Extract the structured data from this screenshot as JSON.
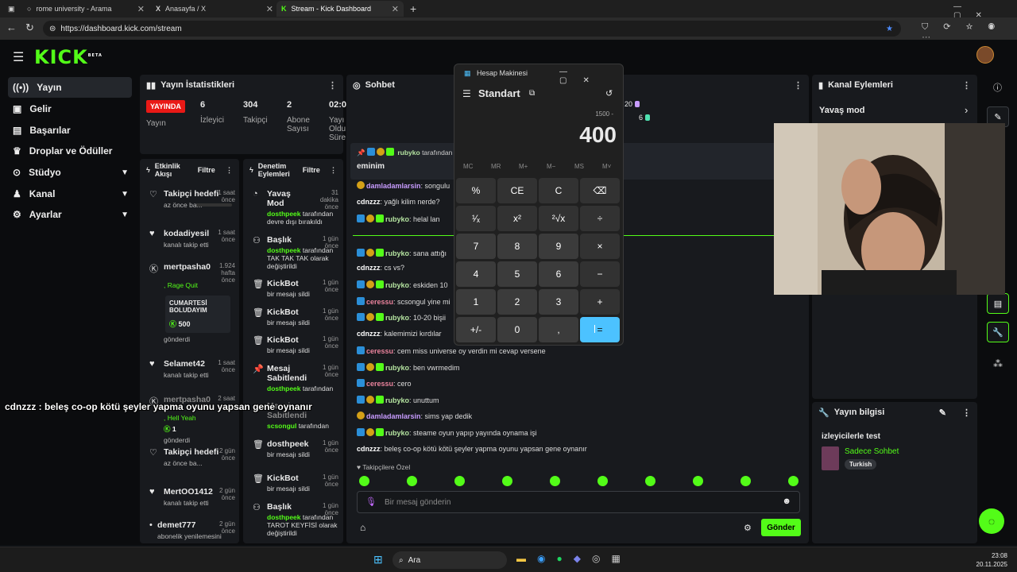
{
  "browser": {
    "tabs": [
      {
        "title": "rome university - Arama",
        "active": false
      },
      {
        "title": "Anasayfa / X",
        "active": false
      },
      {
        "title": "Stream - Kick Dashboard",
        "active": true
      }
    ],
    "url": "https://dashboard.kick.com/stream"
  },
  "kick": {
    "logo": "KICK",
    "logo_sup": "BETA",
    "sidebar": [
      {
        "label": "Yayın",
        "icon": "broadcast-icon",
        "active": true
      },
      {
        "label": "Gelir",
        "icon": "money-icon"
      },
      {
        "label": "Başarılar",
        "icon": "chart-icon"
      },
      {
        "label": "Droplar ve Ödüller",
        "icon": "trophy-icon"
      },
      {
        "label": "Stüdyo",
        "icon": "studio-icon",
        "expand": true
      },
      {
        "label": "Kanal",
        "icon": "people-icon",
        "expand": true
      },
      {
        "label": "Ayarlar",
        "icon": "gear-icon",
        "expand": true
      }
    ],
    "stats": {
      "title": "Yayın İstatistikleri",
      "items": [
        {
          "value": "YAYINDA",
          "label": "Yayın"
        },
        {
          "value": "6",
          "label": "İzleyici"
        },
        {
          "value": "304",
          "label": "Takipçi"
        },
        {
          "value": "2",
          "label": "Abone Sayısı"
        },
        {
          "value": "02:0",
          "label": "Yayı Oldu Süre"
        }
      ]
    },
    "activity": {
      "title": "Etkinlik Akışı",
      "filter": "Filtre",
      "items": [
        {
          "title": "Takipçi hedefi",
          "time": "1 saat önce",
          "sub": "az önce ba..."
        },
        {
          "title": "kodadiyesil",
          "time": "1 saat önce",
          "sub": "kanalı takip etti"
        },
        {
          "title": "mertpasha0",
          "time": "1.924 hafta önce",
          "sub": ", Rage Quit",
          "card": "CUMARTESİ BOLUDAYIM",
          "amount": "500",
          "sub2": "gönderdi"
        },
        {
          "title": "Selamet42",
          "time": "1 saat önce",
          "sub": "kanalı takip etti"
        },
        {
          "title": "mertpasha0",
          "time": "2 saat",
          "sub": ", Hell Yeah",
          "amount": "1",
          "sub2": "gönderdi"
        },
        {
          "title": "Takipçi hedefi",
          "time": "2 gün önce",
          "sub": "az önce ba..."
        },
        {
          "title": "MertOO1412",
          "time": "2 gün önce",
          "sub": "kanalı takip etti"
        },
        {
          "title": "demet777",
          "time": "2 gün önce",
          "sub": "abonelik yenilemesini"
        }
      ]
    },
    "moderation": {
      "title": "Denetim Eylemleri",
      "filter": "Filtre",
      "items": [
        {
          "title": "Yavaş Mod",
          "time": "31 dakika önce",
          "actor": "dosthpeek",
          "rest": "tarafından devre dışı bırakıldı"
        },
        {
          "title": "Başlık",
          "time": "1 gün önce",
          "actor": "dosthpeek",
          "rest": "tarafından TAK TAK TAK olarak değiştirildi"
        },
        {
          "title": "KickBot",
          "time": "1 gün önce",
          "rest": "bir mesajı sildi"
        },
        {
          "title": "KickBot",
          "time": "1 gün önce",
          "rest": "bir mesajı sildi"
        },
        {
          "title": "KickBot",
          "time": "1 gün önce",
          "rest": "bir mesajı sildi"
        },
        {
          "title": "Mesaj Sabitlendi",
          "time": "1 gün önce",
          "actor": "dosthpeek",
          "rest": "tarafından"
        },
        {
          "title": "Mesaj Sabitlendi",
          "time": "",
          "actor": "scsongul",
          "rest": "tarafından"
        },
        {
          "title": "dosthpeek",
          "time": "1 gün önce",
          "rest": "bir mesajı sildi"
        },
        {
          "title": "KickBot",
          "time": "1 gün önce",
          "rest": "bir mesajı sildi"
        },
        {
          "title": "Başlık",
          "time": "1 gün önce",
          "actor": "dosthpeek",
          "rest": "tarafından TAROT KEYFİSİ olarak değiştirildi"
        }
      ]
    },
    "chat": {
      "title": "Sohbet",
      "pinned_user": "rubyko",
      "pinned_suffix": "tarafından",
      "pinned_text": "eminim",
      "top_counts": [
        "20",
        "6"
      ],
      "messages": [
        {
          "user": "damladamlarsin",
          "text": "songulu",
          "color": "purple",
          "badges": [
            "y"
          ]
        },
        {
          "user": "cdnzzz",
          "text": "yağlı kilim nerde?",
          "color": "white",
          "badges": []
        },
        {
          "user": "rubyko",
          "text": "helal lan",
          "color": "green",
          "badges": [
            "b",
            "y",
            "g"
          ]
        },
        {
          "user": "rubyko",
          "text": "sana attığı",
          "color": "green",
          "badges": [
            "b",
            "y",
            "g"
          ]
        },
        {
          "user": "cdnzzz",
          "text": "cs vs?",
          "color": "white",
          "badges": []
        },
        {
          "user": "rubyko",
          "text": "eskiden 10",
          "color": "green",
          "badges": [
            "b",
            "y",
            "g"
          ]
        },
        {
          "user": "ceressu",
          "text": "scsongul yine mi",
          "color": "pink",
          "badges": [
            "b"
          ]
        },
        {
          "user": "rubyko",
          "text": "10-20 bişii",
          "color": "green",
          "badges": [
            "b",
            "y",
            "g"
          ]
        },
        {
          "user": "cdnzzz",
          "text": "kalemimizi kırdılar",
          "color": "white",
          "badges": []
        },
        {
          "user": "ceressu",
          "text": "cem miss universe oy verdin mi cevap versene",
          "color": "pink",
          "badges": [
            "b"
          ]
        },
        {
          "user": "rubyko",
          "text": "ben vwrmedim",
          "color": "green",
          "badges": [
            "b",
            "y",
            "g"
          ]
        },
        {
          "user": "ceressu",
          "text": "cero",
          "color": "pink",
          "badges": [
            "b"
          ]
        },
        {
          "user": "rubyko",
          "text": "unuttum",
          "color": "green",
          "badges": [
            "b",
            "y",
            "g"
          ]
        },
        {
          "user": "damladamlarsin",
          "text": "sims yap dedik",
          "color": "purple",
          "badges": [
            "y"
          ]
        },
        {
          "user": "rubyko",
          "text": "steame oyun yapıp yayında oynama işi",
          "color": "green",
          "badges": [
            "b",
            "y",
            "g"
          ]
        },
        {
          "user": "cdnzzz",
          "text": "beleş co-op kötü kötü şeyler yapma oyunu yapsan gene oynanır",
          "color": "white",
          "badges": []
        }
      ],
      "emote_label": "Takipçilere Özel",
      "input_placeholder": "Bir mesaj gönderin",
      "send_label": "Gönder"
    },
    "actions": {
      "title": "Kanal Eylemleri",
      "slow_mode": "Yavaş mod"
    },
    "stream_info": {
      "title": "Yayın bilgisi",
      "stream_title": "izleyicilerle test",
      "category": "Sadece Sohbet",
      "tag": "Turkish"
    }
  },
  "calculator": {
    "window_title": "Hesap Makinesi",
    "mode": "Standart",
    "expression": "1500 -",
    "display": "400",
    "memory": [
      "MC",
      "MR",
      "M+",
      "M−",
      "MS",
      "M˅"
    ],
    "keys": [
      [
        "%",
        "CE",
        "C",
        "⌫"
      ],
      [
        "¹⁄ₓ",
        "x²",
        "²√x",
        "÷"
      ],
      [
        "7",
        "8",
        "9",
        "×"
      ],
      [
        "4",
        "5",
        "6",
        "−"
      ],
      [
        "1",
        "2",
        "3",
        "+"
      ],
      [
        "+/-",
        "0",
        ",",
        "="
      ]
    ]
  },
  "overlay_caption": "cdnzzz : beleş co-op kötü şeyler yapma oyunu yapsan gene oynanır",
  "taskbar": {
    "search": "Ara",
    "time": "23:08",
    "date": "20.11.2025"
  },
  "colors": {
    "kick_green": "#53fc18",
    "live_red": "#e91916",
    "calc_accent": "#4cc2ff"
  }
}
